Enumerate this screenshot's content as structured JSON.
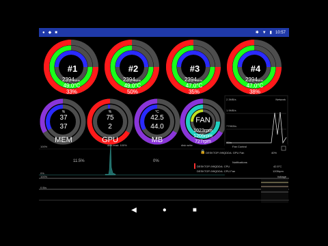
{
  "status_bar": {
    "time": "10:57"
  },
  "cpu_gauges": [
    {
      "label": "#1",
      "clock": "2394",
      "unit": "MHz",
      "temp": "49.0°C",
      "load": "33%"
    },
    {
      "label": "#2",
      "clock": "2394",
      "unit": "MHz",
      "temp": "49.0°C",
      "load": "50%"
    },
    {
      "label": "#3",
      "clock": "2394",
      "unit": "MHz",
      "temp": "47.0°C",
      "load": "35%"
    },
    {
      "label": "#4",
      "clock": "2394",
      "unit": "MHz",
      "temp": "47.0°C",
      "load": "38%"
    }
  ],
  "small_gauges": [
    {
      "label": "MEM",
      "unit": "%",
      "v1": "37",
      "v2": "37"
    },
    {
      "label": "GPU",
      "unit": "%",
      "v1": "75",
      "v2": "2"
    },
    {
      "label": "MB",
      "unit": "°C",
      "v1": "42.5",
      "v2": "44.0"
    },
    {
      "label": "FAN",
      "v1": "1023rpm",
      "v2": "1205rpm",
      "v3": "727rpm"
    }
  ],
  "network": {
    "title": "Network",
    "ticks": [
      "2.3MB/s",
      "1.9MB/s",
      "779KB/s",
      "0B/s"
    ]
  },
  "fan_control": {
    "title": "Fan Control",
    "device": "DESKTOP-9I9QDDA: GPU Fan",
    "value": "40%"
  },
  "notifications": {
    "title": "Notifications",
    "items": [
      {
        "name": "DESKTOP-9I9QDDA: CPU",
        "value": "42.5°C"
      },
      {
        "name": "DESKTOP-9I9QDDA: CPU Fan",
        "value": "1205rpm"
      }
    ]
  },
  "disk": {
    "top_left": "100%",
    "read_label": "disk read: 100%",
    "write_label": "disk write",
    "read_pct": "11.5%",
    "write_pct": "0%",
    "bottom_left": "0%"
  },
  "lower": {
    "left_top": "100%",
    "left_mid": "0 B/s",
    "voltage_title": "Voltage"
  },
  "colors": {
    "red": "#ff1a1a",
    "green": "#1aff1a",
    "blue": "#2a2aff",
    "gray": "#444444",
    "purple": "#8a35d9",
    "cyan": "#20d0c0",
    "yellowgreen": "#c0e020",
    "statusbar": "#1f39a8"
  }
}
